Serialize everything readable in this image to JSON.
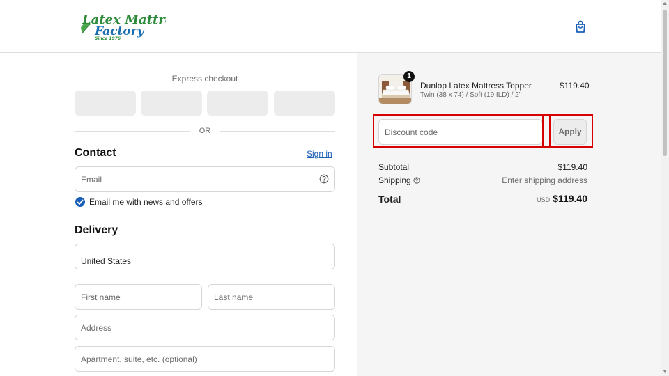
{
  "header": {
    "logo_line1": "Latex Mattress",
    "logo_line2": "Factory",
    "logo_tagline": "Since 1976",
    "cart_icon": "shopping-bag-icon"
  },
  "express": {
    "title": "Express checkout",
    "divider": "OR"
  },
  "contact": {
    "title": "Contact",
    "signin": "Sign in",
    "email_placeholder": "Email",
    "newsletter_label": "Email me with news and offers",
    "newsletter_checked": true
  },
  "delivery": {
    "title": "Delivery",
    "country_value": "United States",
    "first_name_placeholder": "First name",
    "last_name_placeholder": "Last name",
    "address_placeholder": "Address",
    "apartment_placeholder": "Apartment, suite, etc. (optional)"
  },
  "order": {
    "quantity": "1",
    "product_name": "Dunlop Latex Mattress Topper",
    "product_variant": "Twin (38 x 74) / Soft (19 ILD) / 2\"",
    "product_price": "$119.40",
    "discount_placeholder": "Discount code",
    "apply_label": "Apply",
    "subtotal_label": "Subtotal",
    "subtotal_value": "$119.40",
    "shipping_label": "Shipping",
    "shipping_value": "Enter shipping address",
    "total_label": "Total",
    "total_currency": "USD",
    "total_value": "$119.40"
  },
  "colors": {
    "brand_green": "#2e8b3a",
    "brand_blue": "#1b5fb6",
    "highlight_red": "#d60000"
  }
}
